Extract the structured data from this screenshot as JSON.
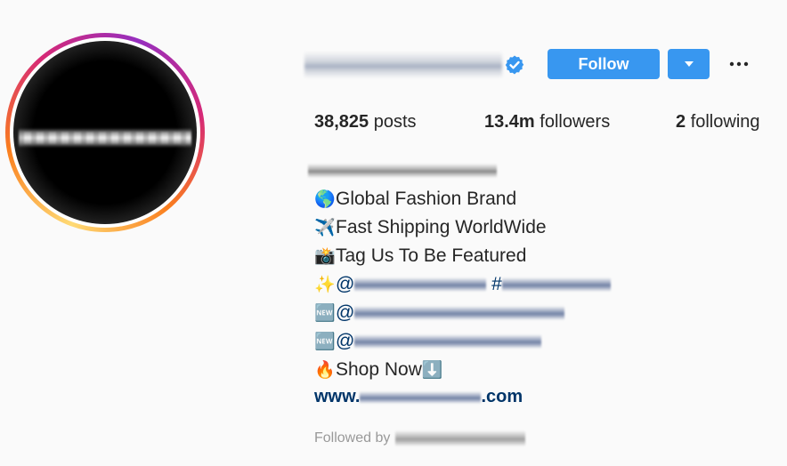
{
  "header": {
    "follow_label": "Follow",
    "accent_color": "#3897f0"
  },
  "stats": {
    "posts_count": "38,825",
    "posts_label": "posts",
    "followers_count": "13.4m",
    "followers_label": "followers",
    "following_count": "2",
    "following_label": "following"
  },
  "bio": {
    "lines": [
      {
        "emoji": "🌎",
        "icon": "globe-icon",
        "text": "Global Fashion Brand"
      },
      {
        "emoji": "✈️",
        "icon": "airplane-icon",
        "text": "Fast Shipping WorldWide"
      },
      {
        "emoji": "📸",
        "icon": "camera-flash-icon",
        "text": "Tag Us To Be Featured"
      },
      {
        "emoji": "✨",
        "icon": "sparkles-icon",
        "mention_prefix": "@",
        "hashtag_prefix": "#"
      },
      {
        "emoji": "🆕",
        "icon": "new-badge-icon",
        "mention_prefix": "@"
      },
      {
        "emoji": "🆕",
        "icon": "new-badge-icon",
        "mention_prefix": "@"
      },
      {
        "emoji": "🔥",
        "icon": "fire-icon",
        "text": "Shop Now",
        "trailing_emoji": "⬇️",
        "trailing_icon": "down-arrow-icon"
      }
    ],
    "website_prefix": "www.",
    "website_suffix": ".com"
  },
  "followed_by_label": "Followed by"
}
